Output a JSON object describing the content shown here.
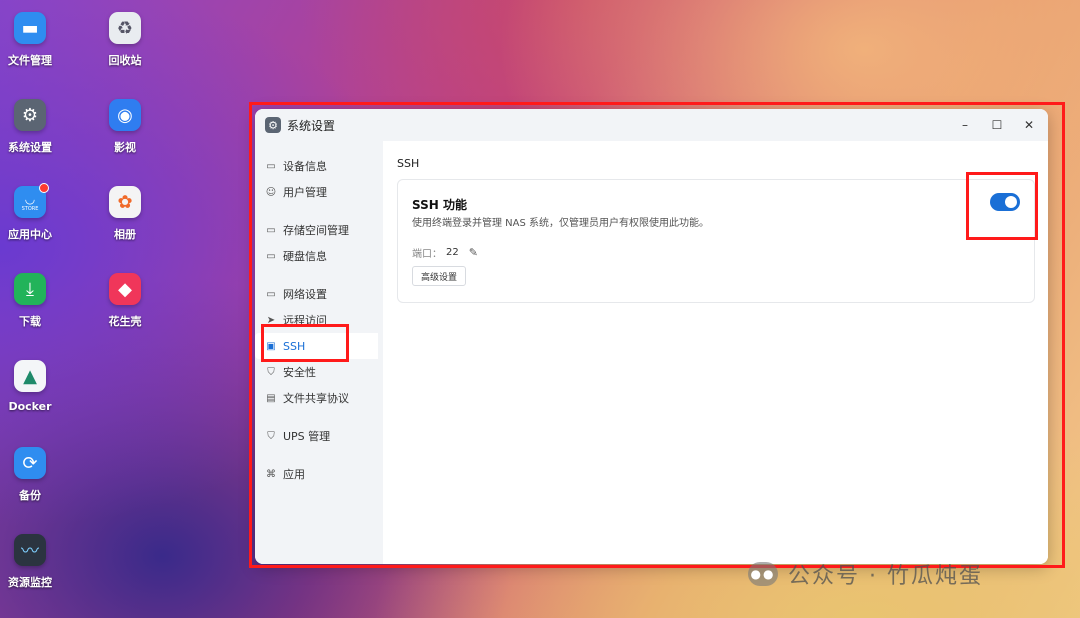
{
  "desktop": {
    "icons": [
      {
        "label": "文件管理",
        "glyph": "▬",
        "color": "#2f8df0"
      },
      {
        "label": "回收站",
        "glyph": "♻",
        "color": "#e9ecf0"
      },
      {
        "label": "系统设置",
        "glyph": "⚙",
        "color": "#5b6573"
      },
      {
        "label": "影视",
        "glyph": "◉",
        "color": "#2f7df0"
      },
      {
        "label": "应用中心",
        "glyph": "◡",
        "color": "#2f8df0"
      },
      {
        "label": "相册",
        "glyph": "✿",
        "color": "#f4f4f4"
      },
      {
        "label": "下载",
        "glyph": "⤓",
        "color": "#22b35a"
      },
      {
        "label": "花生壳",
        "glyph": "◆",
        "color": "#f0365a"
      },
      {
        "label": "Docker",
        "glyph": "▲",
        "color": "#f4f6f8"
      },
      {
        "label": "备份",
        "glyph": "⟳",
        "color": "#2f8df0"
      },
      {
        "label": "资源监控",
        "glyph": "〰",
        "color": "#2b3440"
      }
    ],
    "store_badge": "STORE"
  },
  "window": {
    "title": "系统设置",
    "controls": {
      "minimize": "–",
      "maximize": "☐",
      "close": "✕"
    }
  },
  "sidebar": {
    "items": [
      {
        "label": "设备信息",
        "icon": "▭"
      },
      {
        "label": "用户管理",
        "icon": "☺"
      },
      {
        "label": "存储空间管理",
        "icon": "▭"
      },
      {
        "label": "硬盘信息",
        "icon": "▭"
      },
      {
        "label": "网络设置",
        "icon": "▭"
      },
      {
        "label": "远程访问",
        "icon": "➤"
      },
      {
        "label": "SSH",
        "icon": "▣"
      },
      {
        "label": "安全性",
        "icon": "⛉"
      },
      {
        "label": "文件共享协议",
        "icon": "▤"
      },
      {
        "label": "UPS 管理",
        "icon": "⛉"
      },
      {
        "label": "应用",
        "icon": "⌘"
      }
    ],
    "active_index": 6
  },
  "main": {
    "section_title": "SSH",
    "card": {
      "title": "SSH 功能",
      "description": "使用终端登录并管理 NAS 系统，仅管理员用户有权限使用此功能。",
      "port_label": "端口：",
      "port_value": "22",
      "advanced_button": "高级设置",
      "enabled": true
    }
  },
  "watermark": "公众号 · 竹瓜炖蛋"
}
